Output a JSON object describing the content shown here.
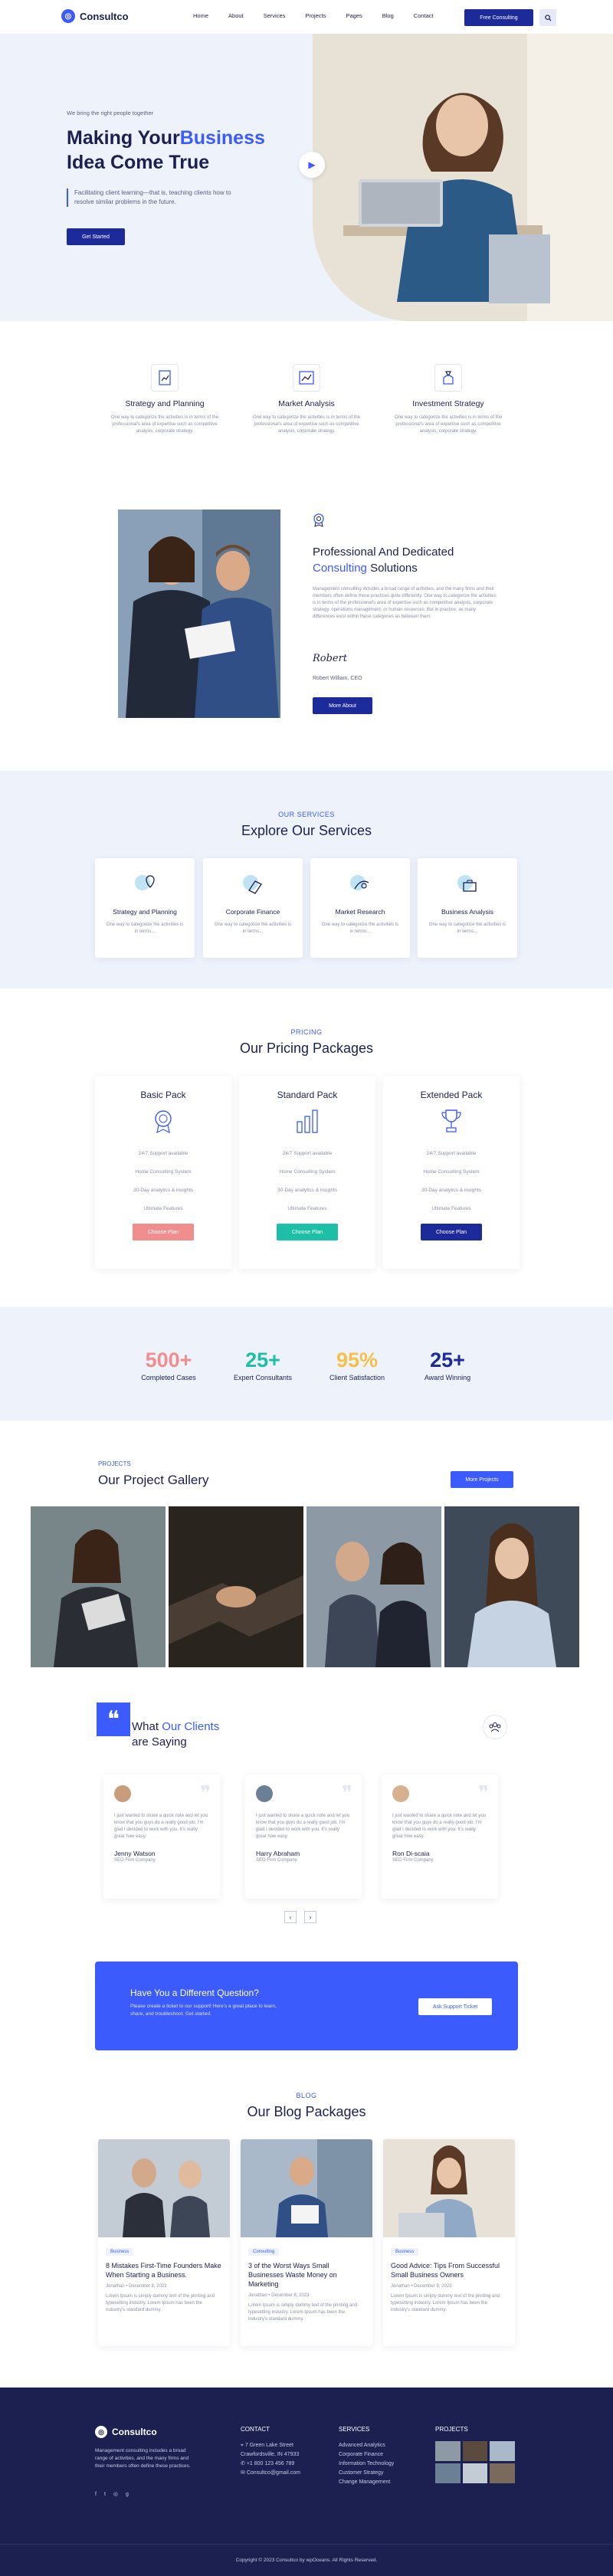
{
  "brand": {
    "name": "Consultco"
  },
  "nav": {
    "items": [
      "Home",
      "About",
      "Services",
      "Projects",
      "Pages",
      "Blog",
      "Contact"
    ],
    "cta": "Free Consulting"
  },
  "hero": {
    "eyebrow": "We bring the right people together",
    "title_a": "Making Your",
    "title_b": "Business",
    "title_c": "Idea Come True",
    "desc": "Facilitating client learning—that is, teaching clients how to resolve similar problems in the future.",
    "cta": "Get Started"
  },
  "features": [
    {
      "title": "Strategy and Planning",
      "text": "One way to categorize the activities is in terms of the professional's area of expertise such as competitive analysis, corporate strategy."
    },
    {
      "title": "Market Analysis",
      "text": "One way to categorize the activities is in terms of the professional's area of expertise such as competitive analysis, corporate strategy."
    },
    {
      "title": "Investment Strategy",
      "text": "One way to categorize the activities is in terms of the professional's area of expertise such as competitive analysis, corporate strategy."
    }
  ],
  "about": {
    "title_a": "Professional And Dedicated",
    "title_b": "Consulting",
    "title_c": "Solutions",
    "p1": "Management consulting includes a broad range of activities, and the many firms and their members often define these practices quite differently. One way to categorize the activities is in terms of the professional's area of expertise such as competitive analysis, corporate strategy, operations management, or human resources. But in practice, as many differences exist within these categories as between them.",
    "signature": "Robert",
    "signer": "Robert William, CEO",
    "cta": "More About"
  },
  "services": {
    "tag": "OUR SERVICES",
    "title": "Explore Our Services",
    "items": [
      {
        "title": "Strategy and Planning",
        "text": "One way to categorize the activities is in terms..."
      },
      {
        "title": "Corporate Finance",
        "text": "One way to categorize the activities is in terms..."
      },
      {
        "title": "Market Research",
        "text": "One way to categorize the activities is in terms..."
      },
      {
        "title": "Business Analysis",
        "text": "One way to categorize the activities is in terms..."
      }
    ]
  },
  "pricing": {
    "tag": "PRICING",
    "title": "Our Pricing Packages",
    "plans": [
      {
        "title": "Basic Pack",
        "features": [
          "24/7 Support available",
          "Home Consulting System",
          "30-Day analytics & insights",
          "Ultimate Features"
        ],
        "cta": "Choose Plan",
        "color": "#f08e8e"
      },
      {
        "title": "Standard Pack",
        "features": [
          "24/7 Support available",
          "Home Consulting System",
          "30-Day analytics & insights",
          "Ultimate Features"
        ],
        "cta": "Choose Plan",
        "color": "#1dbfa6"
      },
      {
        "title": "Extended Pack",
        "features": [
          "24/7 Support available",
          "Home Consulting System",
          "30-Day analytics & insights",
          "Ultimate Features"
        ],
        "cta": "Choose Plan",
        "color": "#1d2a9a"
      }
    ]
  },
  "stats": [
    {
      "value": "500+",
      "label": "Completed Cases",
      "color": "#f08e8e"
    },
    {
      "value": "25+",
      "label": "Expert Consultants",
      "color": "#1dbfa6"
    },
    {
      "value": "95%",
      "label": "Client Satisfaction",
      "color": "#f5c04a"
    },
    {
      "value": "25+",
      "label": "Award Winning",
      "color": "#1d2a9a"
    }
  ],
  "projects": {
    "tag": "PROJECTS",
    "title": "Our Project Gallery",
    "cta": "More Projects"
  },
  "testimonials": {
    "title_a": "What",
    "title_b": "Our Clients",
    "title_c": "are Saying",
    "items": [
      {
        "text": "I just wanted to share a quick note and let you know that you guys do a really good job. I'm glad I decided to work with you. It's really great how easy.",
        "name": "Jenny Watson",
        "role": "SEO Firm Company"
      },
      {
        "text": "I just wanted to share a quick note and let you know that you guys do a really good job. I'm glad I decided to work with you. It's really great how easy.",
        "name": "Harry Abraham",
        "role": "SEO Firm Company"
      },
      {
        "text": "I just wanted to share a quick note and let you know that you guys do a really good job. I'm glad I decided to work with you. It's really great how easy.",
        "name": "Ron Di-scaia",
        "role": "SEO Firm Company"
      }
    ]
  },
  "question": {
    "title": "Have You a Different Question?",
    "text": "Please create a ticket to our support! Here's a great place to learn, share, and troubleshoot. Get started.",
    "cta": "Ask Support Ticket"
  },
  "blog": {
    "tag": "BLOG",
    "title": "Our Blog Packages",
    "posts": [
      {
        "category": "Business",
        "title": "8 Mistakes First-Time Founders Make When Starting a Business.",
        "author": "Jonathan",
        "date": "December 8, 2023",
        "excerpt": "Lorem Ipsum is simply dummy text of the printing and typesetting industry. Lorem Ipsum has been the industry's standard dummy."
      },
      {
        "category": "Consulting",
        "title": "3 of the Worst Ways Small Businesses Waste Money on Marketing",
        "author": "Jonathan",
        "date": "December 8, 2023",
        "excerpt": "Lorem Ipsum is simply dummy text of the printing and typesetting industry. Lorem Ipsum has been the industry's standard dummy."
      },
      {
        "category": "Business",
        "title": "Good Advice: Tips From Successful Small Business Owners",
        "author": "Jonathan",
        "date": "December 8, 2023",
        "excerpt": "Lorem Ipsum is simply dummy text of the printing and typesetting industry. Lorem Ipsum has been the industry's standard dummy."
      }
    ]
  },
  "footer": {
    "about": "Management consulting includes a broad range of activities, and the many firms and their members often define these practices.",
    "contact_h": "CONTACT",
    "address1": "7 Green Lake Street",
    "address2": "Crawfordsville, IN 47933",
    "phone": "+1 800 123 456 789",
    "email": "Consultco@gmail.com",
    "services_h": "SERVICES",
    "services": [
      "Advanced Analytics",
      "Corporate Finance",
      "Information Technology",
      "Customer Strategy",
      "Change Management"
    ],
    "projects_h": "PROJECTS",
    "copyright": "Copyright © 2023 Consultco by wpOceans. All Rights Reserved."
  }
}
